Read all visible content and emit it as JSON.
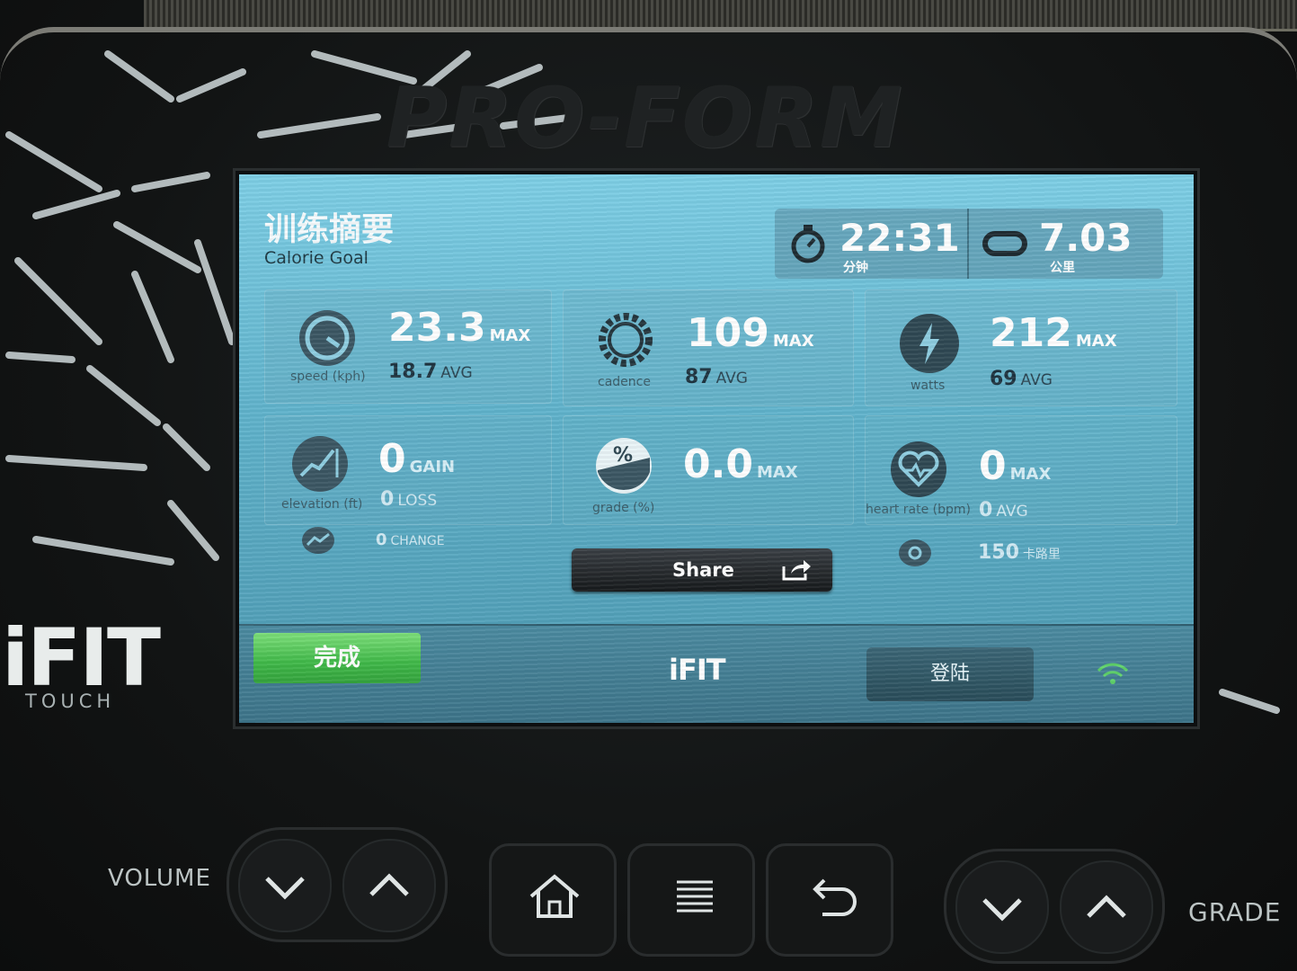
{
  "console": {
    "brand": "PRO-FORM",
    "ifit_logo": "iFIT",
    "ifit_sub": "TOUCH",
    "volume_label": "VOLUME",
    "grade_label": "GRADE"
  },
  "screen": {
    "title": "训练摘要",
    "subtitle": "Calorie Goal",
    "summary": {
      "time": {
        "value": "22:31",
        "unit": "分钟",
        "icon": "stopwatch-icon"
      },
      "distance": {
        "value": "7.03",
        "unit": "公里",
        "icon": "track-icon"
      }
    },
    "stats": {
      "speed": {
        "label": "speed (kph)",
        "max": "23.3",
        "max_suffix": "MAX",
        "avg": "18.7",
        "avg_suffix": "AVG",
        "icon": "speedometer-icon"
      },
      "cadence": {
        "label": "cadence",
        "max": "109",
        "max_suffix": "MAX",
        "avg": "87",
        "avg_suffix": "AVG",
        "icon": "gear-icon"
      },
      "watts": {
        "label": "watts",
        "max": "212",
        "max_suffix": "MAX",
        "avg": "69",
        "avg_suffix": "AVG",
        "icon": "lightning-icon"
      },
      "elevation": {
        "label": "elevation (ft)",
        "gain": "0",
        "gain_suffix": "GAIN",
        "loss": "0",
        "loss_suffix": "LOSS",
        "change": "0",
        "change_suffix": "CHANGE",
        "icon": "elevation-icon"
      },
      "grade": {
        "label": "grade (%)",
        "max": "0.0",
        "max_suffix": "MAX",
        "icon": "percent-icon"
      },
      "heart_rate": {
        "label": "heart rate (bpm)",
        "max": "0",
        "max_suffix": "MAX",
        "avg": "0",
        "avg_suffix": "AVG",
        "extra": "150",
        "extra_suffix": "卡路里",
        "icon": "heart-icon"
      }
    },
    "share_label": "Share",
    "done_label": "完成",
    "bar_logo": "iFIT",
    "login_label": "登陆"
  },
  "colors": {
    "screen_top": "#7ecfe6",
    "screen_bottom": "#4c98b0",
    "done_green": "#3fb848",
    "bezel": "#121414"
  }
}
